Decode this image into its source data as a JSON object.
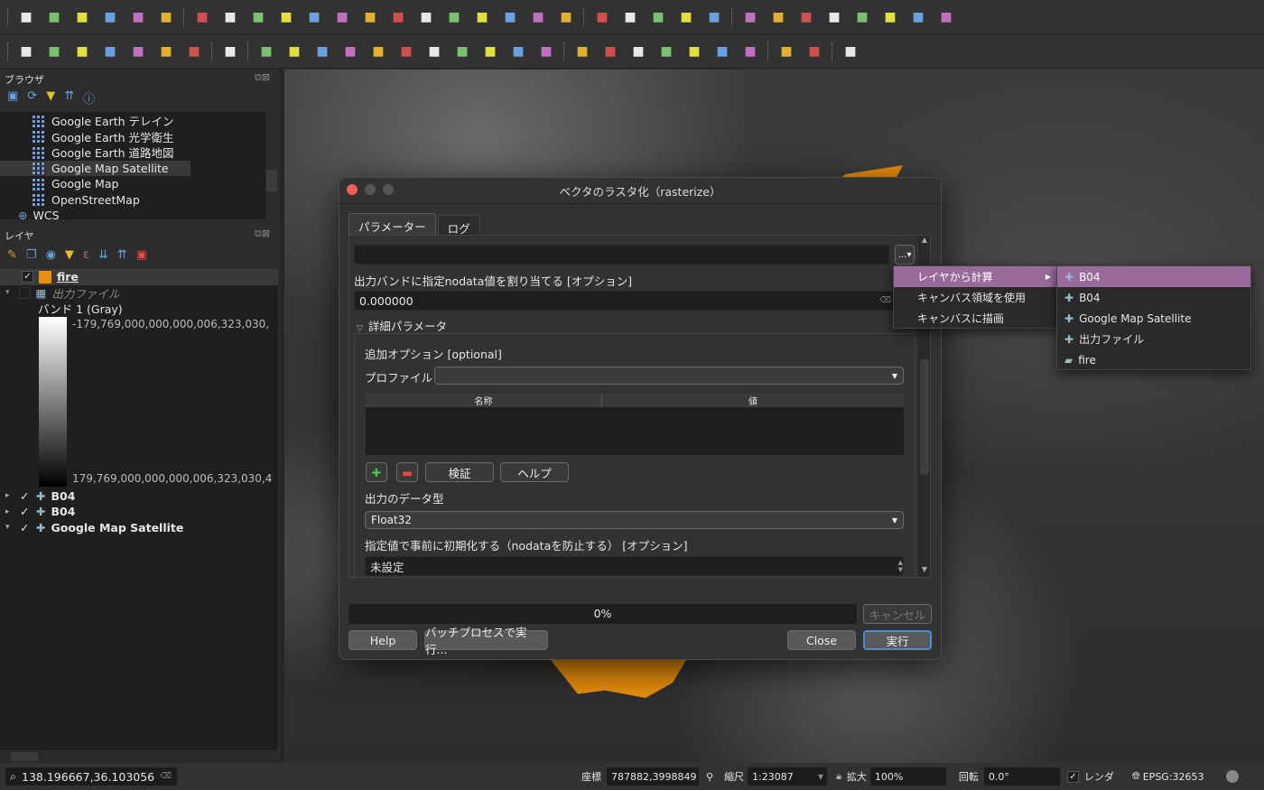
{
  "toolbar1": [
    "new-project",
    "open-project",
    "save-project",
    "save-as",
    "print-layout",
    "style-manager",
    "pan",
    "pan-to-selection",
    "zoom-in",
    "zoom-out",
    "zoom-full",
    "zoom-to-selection",
    "zoom-to-layer",
    "zoom-native",
    "zoom-last",
    "zoom-next",
    "new-bookmark",
    "show-bookmarks",
    "temporal",
    "clock",
    "refresh",
    "select-features",
    "select-by-value",
    "deselect",
    "select-location",
    "identify",
    "attribute-table",
    "settings",
    "statistics",
    "open-table",
    "measure",
    "annotation",
    "map-tips"
  ],
  "toolbar2": [
    "add-layer",
    "digitize",
    "vertex",
    "new-shapefile",
    "new-geopackage",
    "new-memory",
    "new-virtual",
    "current-edits",
    "toggle-editing",
    "save-edits",
    "add-feature",
    "vertex-tool",
    "modify-attributes",
    "delete",
    "cut",
    "copy",
    "paste",
    "undo",
    "redo",
    "label",
    "diagram",
    "label-pin",
    "label-show",
    "label-move",
    "label-rotate",
    "label-change",
    "plugin-manager",
    "python",
    "help"
  ],
  "browser": {
    "title": "ブラウザ",
    "items": [
      "Google Earth テレイン",
      "Google Earth 光学衛生",
      "Google Earth 道路地図",
      "Google Map Satellite",
      "Google Map",
      "OpenStreetMap"
    ],
    "wcs": "WCS"
  },
  "layers": {
    "title": "レイヤ",
    "fire": "fire",
    "output": "出力ファイル",
    "band": "バンド 1 (Gray)",
    "max": "-179,769,000,000,000,006,323,030,",
    "min": "179,769,000,000,000,006,323,030,4",
    "others": [
      "B04",
      "B04",
      "Google Map Satellite"
    ]
  },
  "dialog": {
    "title": "ベクタのラスタ化（rasterize）",
    "tabs": [
      "パラメーター",
      "ログ"
    ],
    "nodata_label": "出力バンドに指定nodata値を割り当てる [オプション]",
    "nodata_value": "0.000000",
    "advanced": "詳細パラメータ",
    "extra_label": "追加オプション [optional]",
    "profile_label": "プロファイル",
    "col_name": "名称",
    "col_value": "値",
    "validate": "検証",
    "help_small": "ヘルプ",
    "dtype_label": "出力のデータ型",
    "dtype": "Float32",
    "init_label": "指定値で事前に初期化する（nodataを防止する） [オプション]",
    "init_value": "未設定",
    "progress": "0%",
    "progress_value": 0,
    "cancel": "キャンセル",
    "help": "Help",
    "batch": "バッチプロセスで実行...",
    "close": "Close",
    "run": "実行"
  },
  "menu": {
    "items": [
      "レイヤから計算",
      "キャンバス領域を使用",
      "キャンバスに描画"
    ],
    "sub": [
      "B04",
      "B04",
      "Google Map Satellite",
      "出力ファイル",
      "fire"
    ]
  },
  "status": {
    "locator": "138.196667,36.103056",
    "coord_label": "座標",
    "coord": "787882,3998849",
    "scale_label": "縮尺",
    "scale": "1:23087",
    "mag_label": "拡大",
    "mag": "100%",
    "rot_label": "回転",
    "rot": "0.0°",
    "render": "レンダ",
    "crs": "EPSG:32653"
  },
  "colors": {
    "accent": "#9a6a9a",
    "fire": "#e8900c"
  }
}
